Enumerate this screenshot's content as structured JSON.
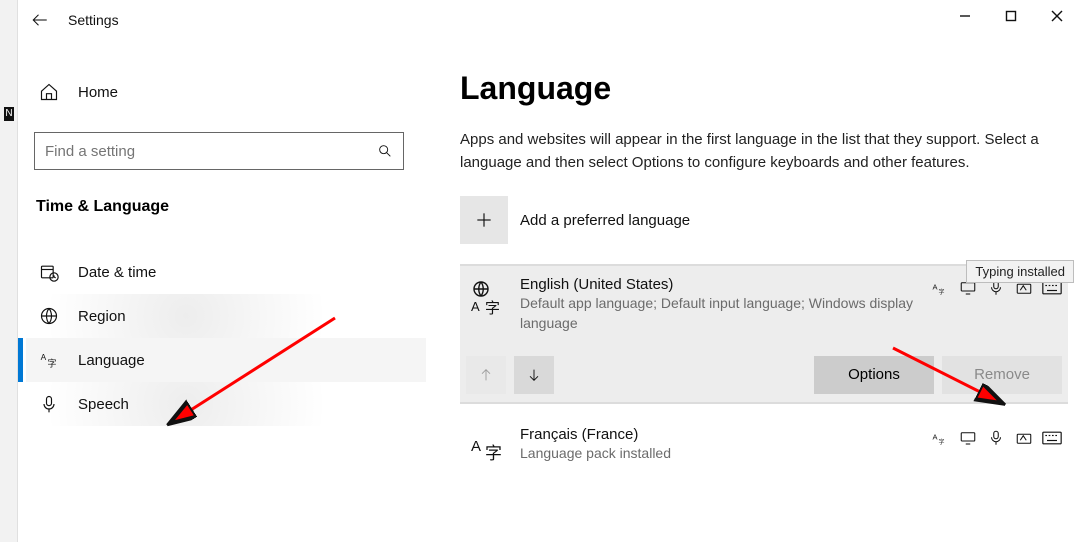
{
  "window": {
    "title": "Settings"
  },
  "sidebar": {
    "home_label": "Home",
    "search_placeholder": "Find a setting",
    "section_title": "Time & Language",
    "items": [
      {
        "label": "Date & time"
      },
      {
        "label": "Region"
      },
      {
        "label": "Language"
      },
      {
        "label": "Speech"
      }
    ]
  },
  "main": {
    "heading": "Language",
    "description": "Apps and websites will appear in the first language in the list that they support. Select a language and then select Options to configure keyboards and other features.",
    "add_label": "Add a preferred language",
    "tooltip": "Typing installed",
    "buttons": {
      "options": "Options",
      "remove": "Remove"
    },
    "languages": [
      {
        "name": "English (United States)",
        "subtitle": "Default app language; Default input language; Windows display language"
      },
      {
        "name": "Français (France)",
        "subtitle": "Language pack installed"
      }
    ]
  }
}
